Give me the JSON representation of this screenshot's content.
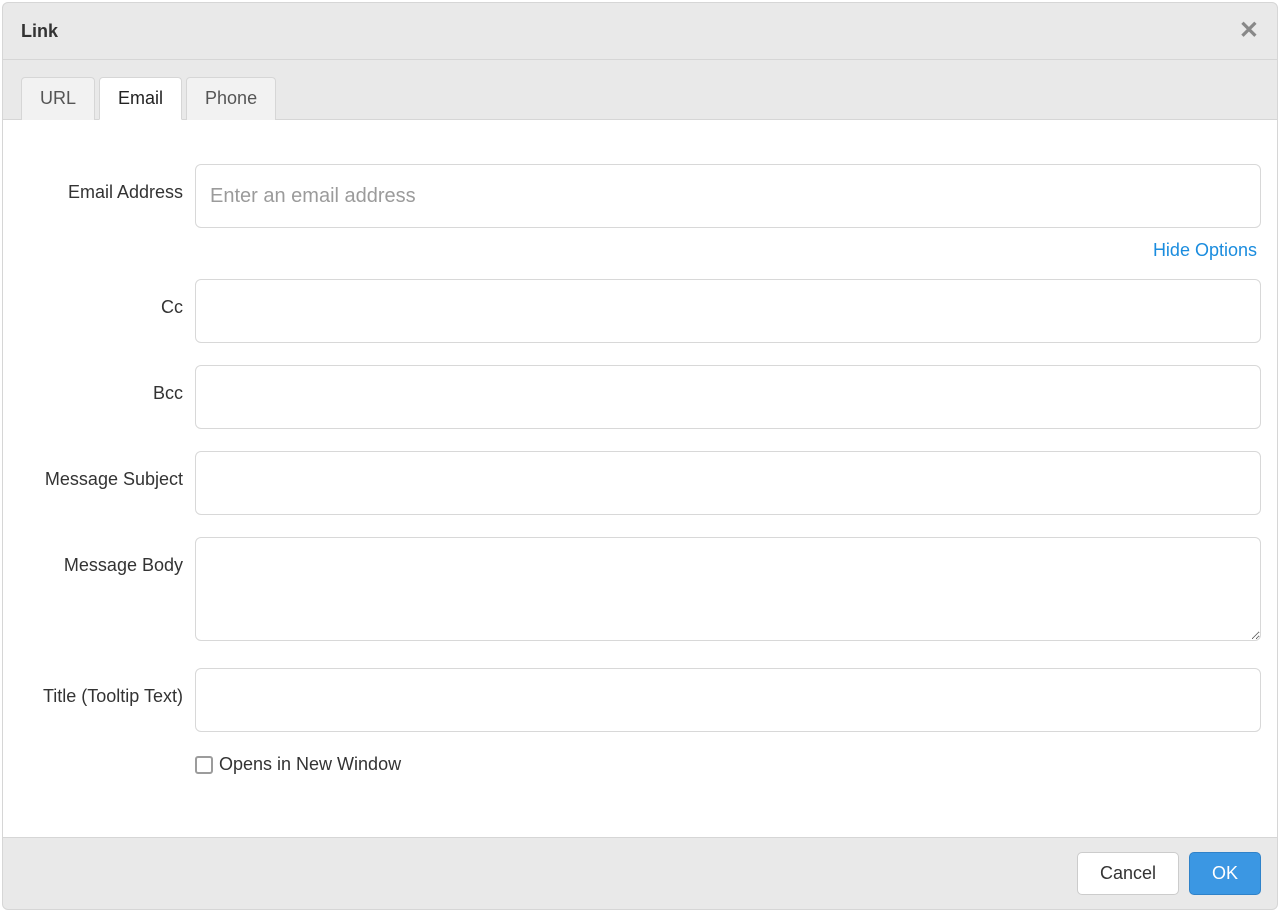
{
  "dialog": {
    "title": "Link"
  },
  "tabs": {
    "url": "URL",
    "email": "Email",
    "phone": "Phone"
  },
  "labels": {
    "email_address": "Email Address",
    "cc": "Cc",
    "bcc": "Bcc",
    "message_subject": "Message Subject",
    "message_body": "Message Body",
    "title_tooltip": "Title (Tooltip Text)",
    "opens_new_window": "Opens in New Window"
  },
  "placeholders": {
    "email": "Enter an email address"
  },
  "values": {
    "email": "",
    "cc": "",
    "bcc": "",
    "subject": "",
    "body": "",
    "title": "",
    "new_window_checked": false
  },
  "actions": {
    "hide_options": "Hide Options",
    "cancel": "Cancel",
    "ok": "OK"
  }
}
